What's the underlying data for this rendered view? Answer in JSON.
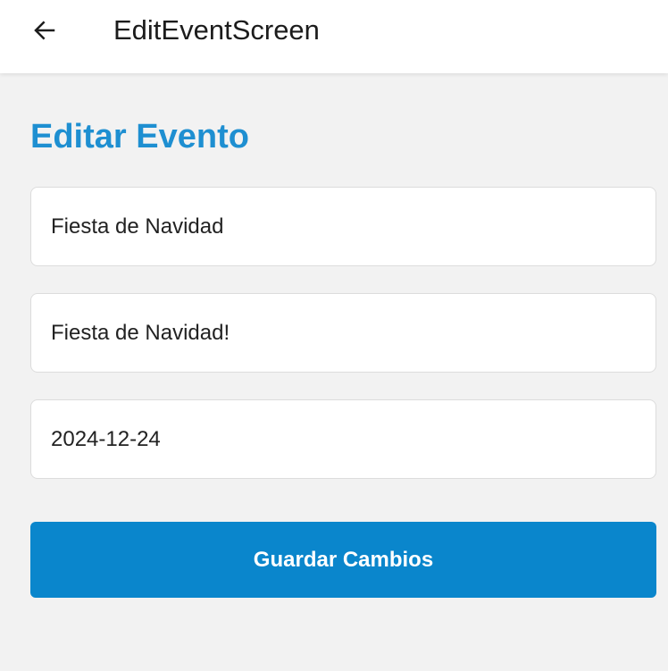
{
  "app_bar": {
    "back_icon": "arrow-left-icon",
    "title": "EditEventScreen"
  },
  "form": {
    "heading": "Editar Evento",
    "heading_color": "#1e8fd1",
    "title_field": {
      "value": "Fiesta de Navidad"
    },
    "description_field": {
      "value": "Fiesta de Navidad!"
    },
    "date_field": {
      "value": "2024-12-24"
    },
    "save_label": "Guardar Cambios",
    "button_color": "#0a86cc"
  }
}
